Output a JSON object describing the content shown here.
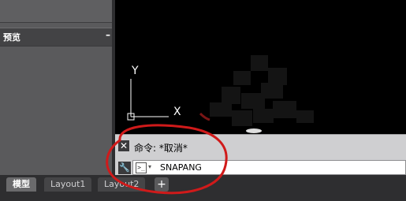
{
  "left_panel": {
    "preview_title": "预览",
    "collapse_label": "–"
  },
  "canvas": {
    "ucs_y_label": "Y",
    "ucs_x_label": "X"
  },
  "command": {
    "close_glyph": "✕",
    "history_text": "命令: *取消*",
    "customize_glyph": "🔧",
    "prompt_glyph": ">_",
    "dropdown_glyph": "▾",
    "input_value": "SNAPANG"
  },
  "tabs": {
    "items": [
      {
        "label": "模型"
      },
      {
        "label": "Layout1"
      },
      {
        "label": "Layout2"
      }
    ],
    "add_label": "+"
  },
  "colors": {
    "annotation_red": "#d01a1a",
    "canvas_bg": "#000000"
  }
}
